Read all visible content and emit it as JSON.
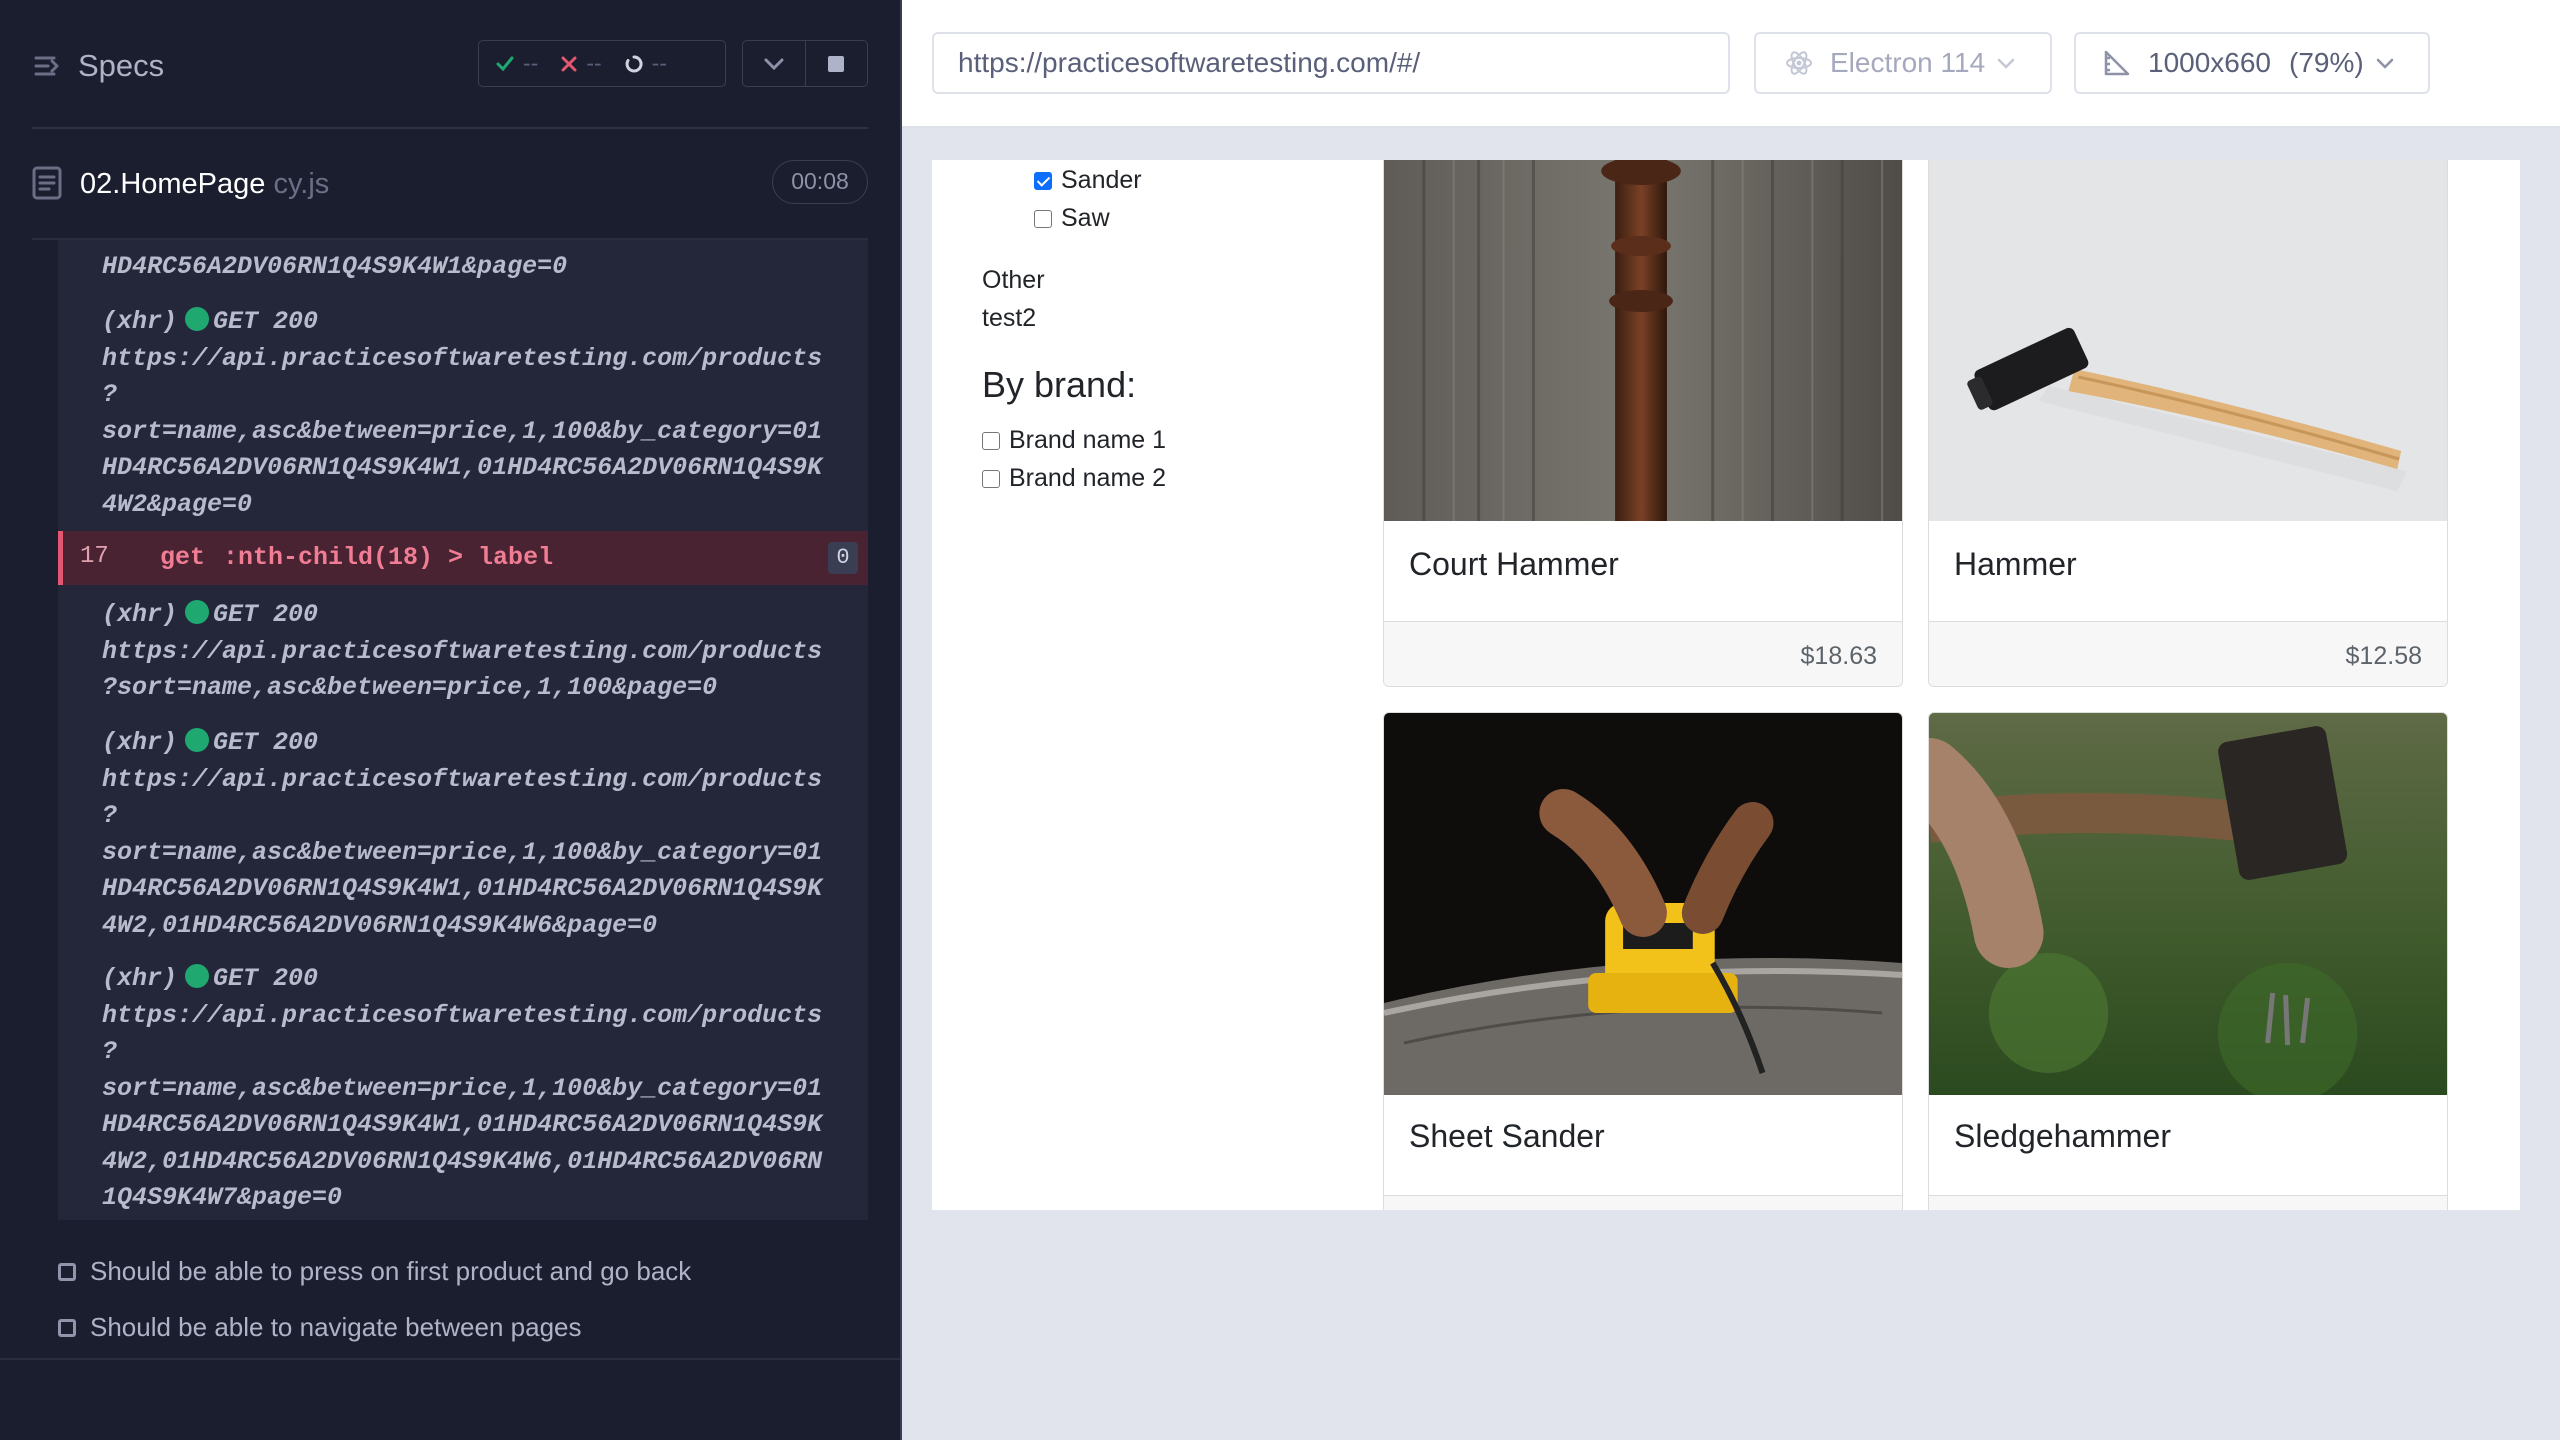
{
  "reporter": {
    "title": "Specs",
    "stats": {
      "passed": "--",
      "failed": "--",
      "pending": "--"
    },
    "spec": {
      "name": "02.HomePage",
      "ext": " cy.js",
      "time": "00:08"
    },
    "log": [
      {
        "text": "HD4RC56A2DV06RN1Q4S9K4W1&page=0"
      },
      {
        "prefix": "(xhr)",
        "status": "GET 200",
        "lines": [
          "https://api.practicesoftwaretesting.com/products",
          "?",
          "sort=name,asc&between=price,1,100&by_category=01",
          "HD4RC56A2DV06RN1Q4S9K4W1,01HD4RC56A2DV06RN1Q4S9K",
          "4W2&page=0"
        ]
      },
      {
        "prefix": "(xhr)",
        "status": "GET 200",
        "lines": [
          "https://api.practicesoftwaretesting.com/products",
          "?sort=name,asc&between=price,1,100&page=0"
        ]
      },
      {
        "prefix": "(xhr)",
        "status": "GET 200",
        "lines": [
          "https://api.practicesoftwaretesting.com/products",
          "?",
          "sort=name,asc&between=price,1,100&by_category=01",
          "HD4RC56A2DV06RN1Q4S9K4W1,01HD4RC56A2DV06RN1Q4S9K",
          "4W2,01HD4RC56A2DV06RN1Q4S9K4W6&page=0"
        ]
      },
      {
        "prefix": "(xhr)",
        "status": "GET 200",
        "lines": [
          "https://api.practicesoftwaretesting.com/products",
          "?",
          "sort=name,asc&between=price,1,100&by_category=01",
          "HD4RC56A2DV06RN1Q4S9K4W1,01HD4RC56A2DV06RN1Q4S9K",
          "4W2,01HD4RC56A2DV06RN1Q4S9K4W6,01HD4RC56A2DV06RN",
          "1Q4S9K4W7&page=0"
        ]
      }
    ],
    "command": {
      "number": "17",
      "name": "get",
      "selector": ":nth-child(18) > label",
      "count": "0"
    },
    "tests": [
      "Should be able to press on first product and go back",
      "Should be able to navigate between pages"
    ]
  },
  "topbar": {
    "url": "https://practicesoftwaretesting.com/#/",
    "browser": "Electron 114",
    "viewport": "1000x660",
    "viewport_pct": "(79%)"
  },
  "aut": {
    "filters": [
      {
        "label": "Sander",
        "checked": true
      },
      {
        "label": "Saw",
        "checked": false
      }
    ],
    "other": {
      "label": "Other",
      "value": "test2"
    },
    "brand_heading": "By brand:",
    "brands": [
      {
        "label": "Brand name 1",
        "checked": false
      },
      {
        "label": "Brand name 2",
        "checked": false
      }
    ],
    "products": [
      {
        "name": "Court Hammer",
        "price": "$18.63"
      },
      {
        "name": "Hammer",
        "price": "$12.58"
      },
      {
        "name": "Sheet Sander"
      },
      {
        "name": "Sledgehammer"
      }
    ]
  },
  "colors": {
    "reporter_bg": "#1b1e2e",
    "pass": "#1fa971",
    "fail": "#e45770",
    "accent": "#0b6efd"
  }
}
